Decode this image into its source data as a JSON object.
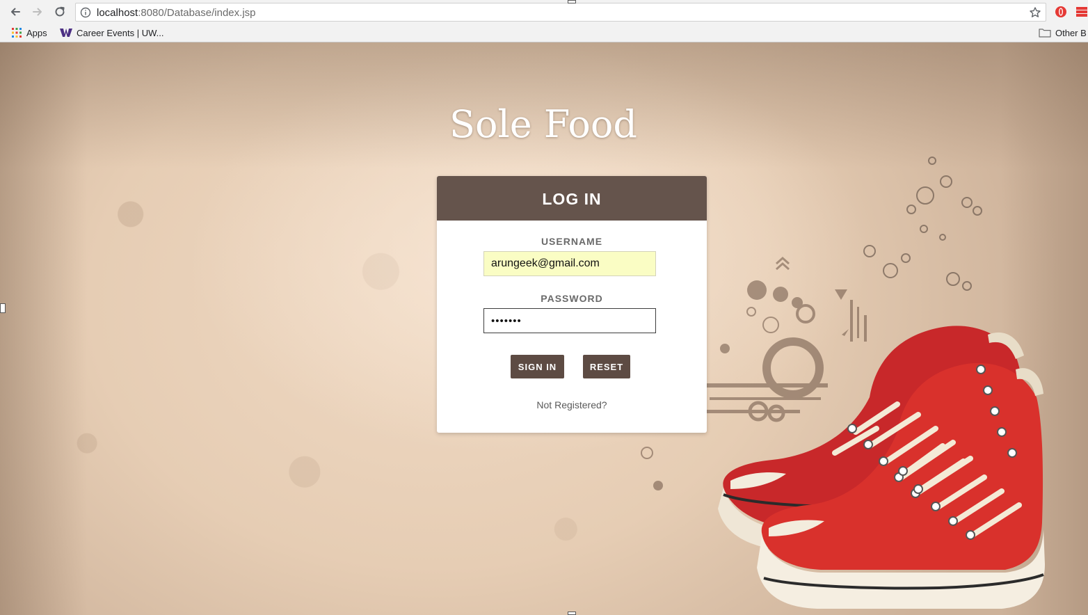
{
  "browser": {
    "url_host": "localhost",
    "url_path": ":8080/Database/index.jsp",
    "bookmarks": [
      {
        "label": "Apps",
        "icon": "apps-grid-icon"
      },
      {
        "label": "Career Events | UW...",
        "icon": "uw-w-icon"
      }
    ],
    "other_bookmarks_label": "Other B"
  },
  "page": {
    "site_title": "Sole Food"
  },
  "login": {
    "title": "LOG IN",
    "username_label": "USERNAME",
    "username_value": "arungeek@gmail.com",
    "password_label": "PASSWORD",
    "password_value": "•••••••",
    "sign_in_label": "SIGN IN",
    "reset_label": "RESET",
    "not_registered_label": "Not Registered?"
  },
  "colors": {
    "card_header": "#65544c",
    "button": "#5d4b43",
    "autofill_bg": "#fafdc4",
    "sneaker_red": "#d9312c"
  }
}
